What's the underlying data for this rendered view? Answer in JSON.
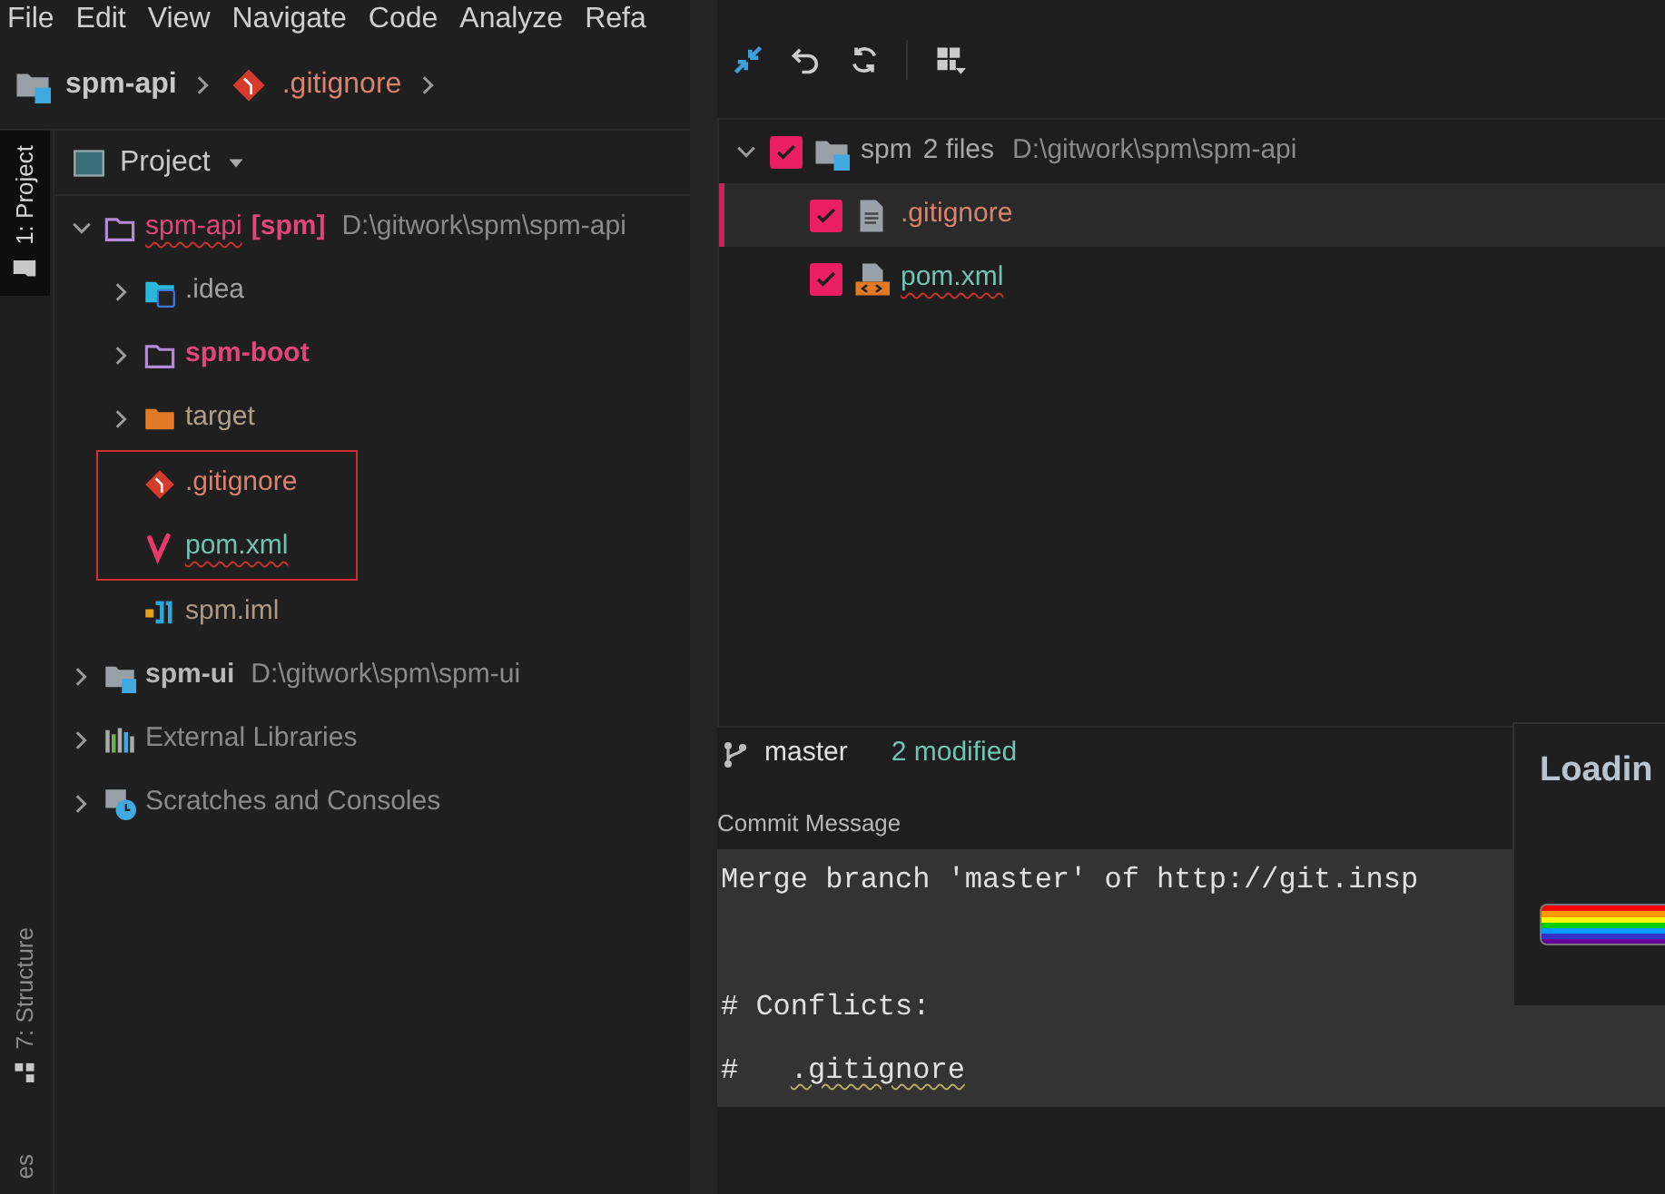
{
  "menu": [
    {
      "label": "File"
    },
    {
      "label": "Edit"
    },
    {
      "label": "View"
    },
    {
      "label": "Navigate"
    },
    {
      "label": "Code"
    },
    {
      "label": "Analyze"
    },
    {
      "label": "Refa"
    }
  ],
  "breadcrumb": [
    {
      "label": "spm-api",
      "kind": "module"
    },
    {
      "label": ".gitignore",
      "kind": "git"
    }
  ],
  "side_tabs": [
    {
      "label": "1: Project",
      "selected": true
    },
    {
      "label": "7: Structure",
      "selected": false
    },
    {
      "label": "es",
      "selected": false
    }
  ],
  "project_panel": {
    "title": "Project",
    "tree": [
      {
        "label": "spm-api",
        "tag": "[spm]",
        "path": "D:\\gitwork\\spm\\spm-api",
        "kind": "module",
        "color": "#e0467a",
        "spellcheck_error": true,
        "expanded": true,
        "children": [
          {
            "label": ".idea",
            "kind": "idea",
            "color": "#a0a0a0",
            "expanded": false
          },
          {
            "label": "spm-boot",
            "kind": "module",
            "color": "#e0467a",
            "bold": true,
            "expanded": false
          },
          {
            "label": "target",
            "kind": "excluded",
            "color": "#b0a088",
            "expanded": false
          },
          {
            "label": ".gitignore",
            "kind": "git",
            "color": "#d9826c",
            "highlighted": true
          },
          {
            "label": "pom.xml",
            "kind": "maven",
            "color": "#6fc3b0",
            "spellcheck_error": true,
            "highlighted": true
          },
          {
            "label": "spm.iml",
            "kind": "iml",
            "color": "#b09880"
          }
        ]
      },
      {
        "label": "spm-ui",
        "path": "D:\\gitwork\\spm\\spm-ui",
        "kind": "module-grey",
        "color": "#b8b8b8",
        "bold": true,
        "expanded": false
      },
      {
        "label": "External Libraries",
        "kind": "libraries",
        "color": "#8a8a8a",
        "expanded": false
      },
      {
        "label": "Scratches and Consoles",
        "kind": "scratches",
        "color": "#8a8a8a",
        "expanded": false
      }
    ]
  },
  "changes": {
    "root": {
      "label": "spm",
      "count": "2 files",
      "path": "D:\\gitwork\\spm\\spm-api",
      "checked": true,
      "expanded": true
    },
    "files": [
      {
        "name": ".gitignore",
        "kind": "text",
        "color": "#d9826c",
        "checked": true,
        "selected": true
      },
      {
        "name": "pom.xml",
        "kind": "xml",
        "color": "#6fc3b0",
        "checked": true,
        "selected": false,
        "spellcheck_error": true
      }
    ]
  },
  "branch": {
    "name": "master",
    "status": "2 modified"
  },
  "commit_message": {
    "label": "Commit Message",
    "lines": [
      {
        "kind": "text",
        "text": "Merge branch 'master' of http://git.insp"
      },
      {
        "kind": "blank"
      },
      {
        "kind": "text",
        "text": "# Conflicts:"
      },
      {
        "kind": "flagged",
        "text": "#   ",
        "flagged": ".gitignore"
      }
    ]
  },
  "loading_popup": {
    "title": "Loadin"
  }
}
